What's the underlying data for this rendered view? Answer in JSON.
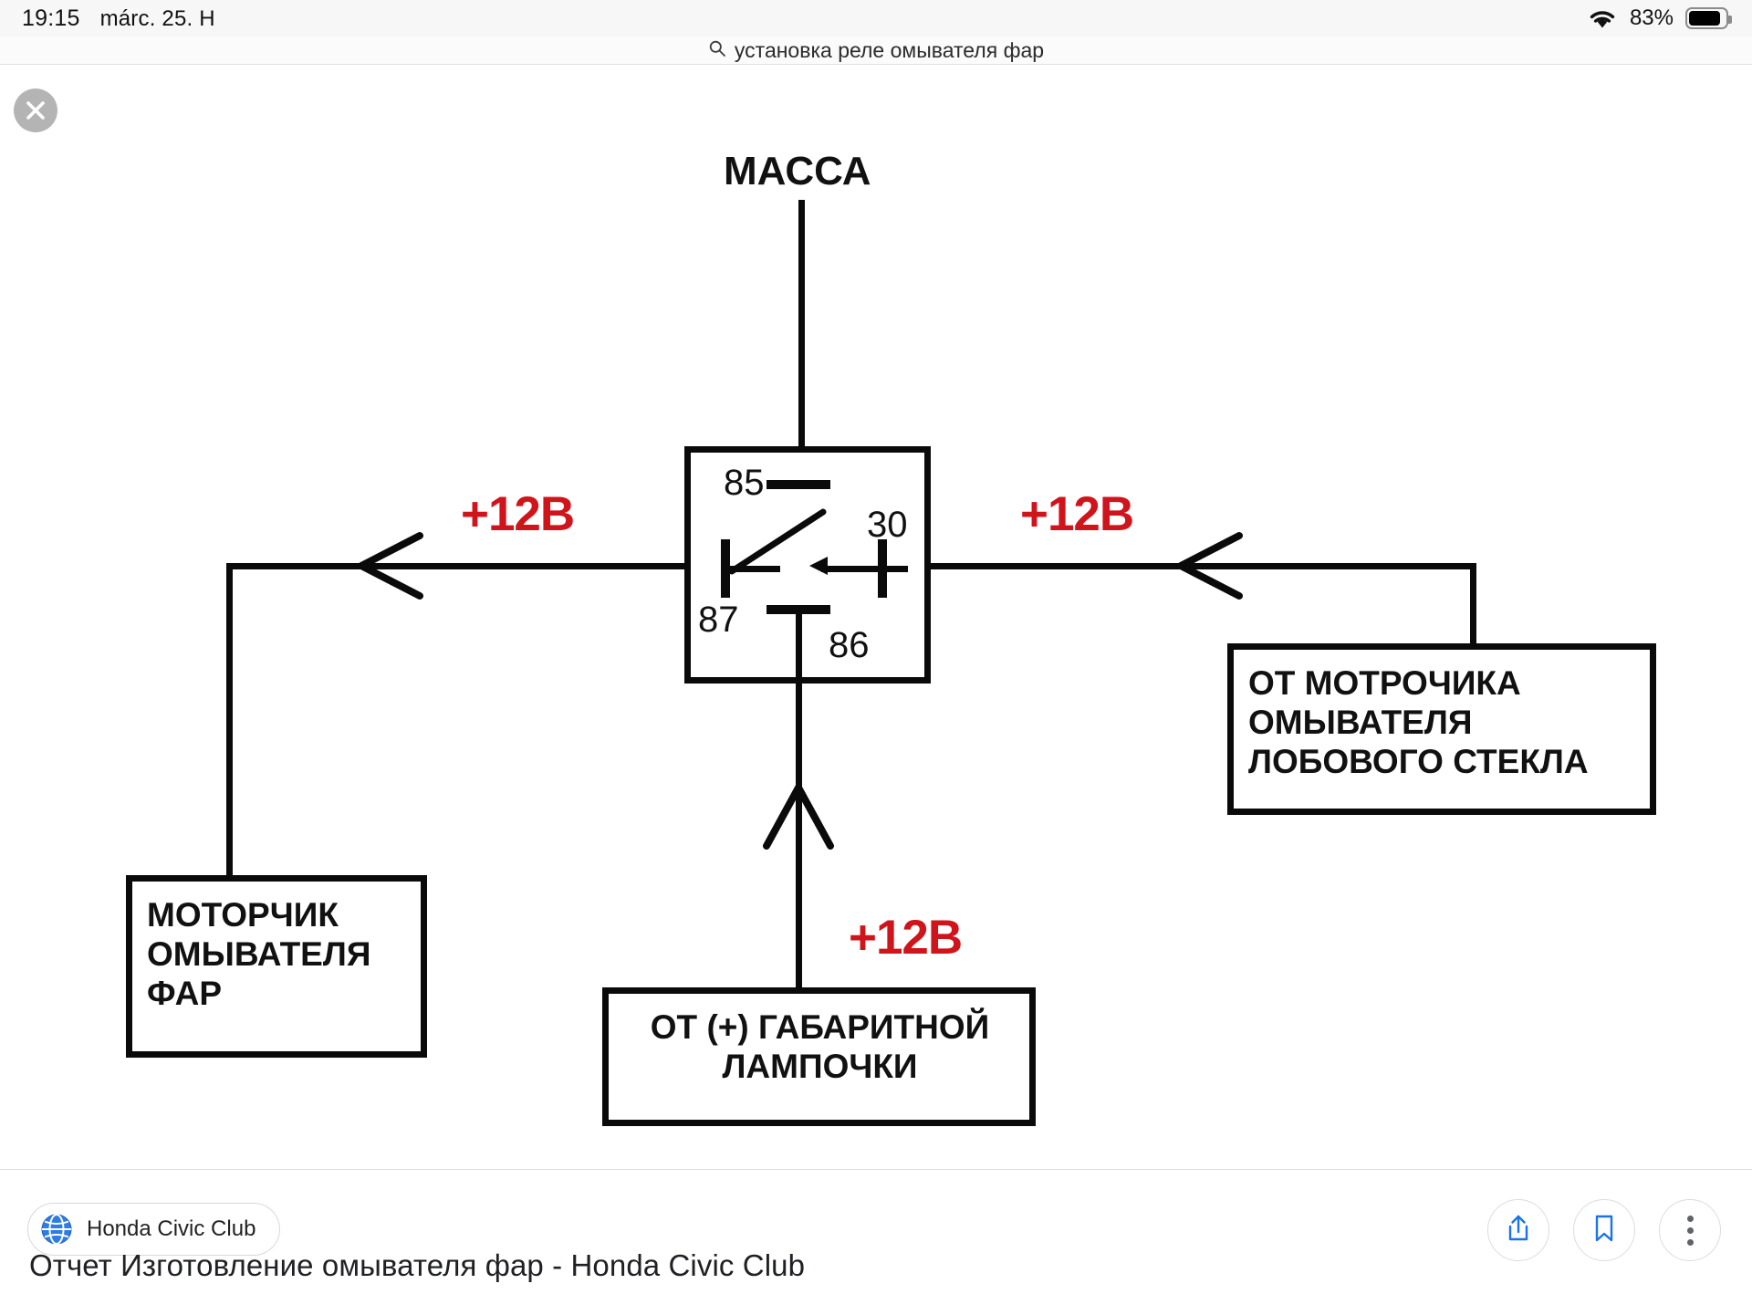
{
  "status_bar": {
    "time": "19:15",
    "date": "márc. 25. H",
    "wifi_icon": "wifi-icon",
    "battery_percent": "83%",
    "battery_icon": "battery-icon"
  },
  "search": {
    "icon": "search-icon",
    "query": "установка реле омывателя фар"
  },
  "viewer": {
    "close_icon": "close-icon"
  },
  "diagram": {
    "title_label": "МАССА",
    "relay": {
      "terminals": [
        {
          "id": "85",
          "label": "85",
          "position": "top-left-inside"
        },
        {
          "id": "30",
          "label": "30",
          "position": "right"
        },
        {
          "id": "87",
          "label": "87",
          "position": "left"
        },
        {
          "id": "86",
          "label": "86",
          "position": "bottom"
        }
      ]
    },
    "voltage_labels": [
      {
        "id": "left",
        "text": "+12B"
      },
      {
        "id": "right",
        "text": "+12B"
      },
      {
        "id": "bottom",
        "text": "+12B"
      }
    ],
    "boxes": [
      {
        "id": "headlight-washer-motor",
        "lines": [
          "МОТОРЧИК",
          "ОМЫВАТЕЛЯ",
          "ФАР"
        ],
        "align": "left"
      },
      {
        "id": "windshield-washer-motor",
        "lines": [
          "ОТ МОТРОЧИКА",
          "ОМЫВАТЕЛЯ",
          "ЛОБОВОГО СТЕКЛА"
        ],
        "align": "left"
      },
      {
        "id": "parking-lamp-positive",
        "lines": [
          "ОТ (+) ГАБАРИТНОЙ",
          "ЛАМПОЧКИ"
        ],
        "align": "center"
      }
    ],
    "colors": {
      "wire": "#0a0a0a",
      "voltage_text": "#d0141b",
      "background": "#ffffff"
    }
  },
  "bottom": {
    "source_icon": "globe-icon",
    "source_name": "Honda Civic Club",
    "actions": [
      {
        "id": "share",
        "icon": "share-icon"
      },
      {
        "id": "bookmark",
        "icon": "bookmark-icon"
      },
      {
        "id": "more",
        "icon": "more-vertical-icon"
      }
    ],
    "page_title": "Отчет Изготовление омывателя фар - Honda Civic Club"
  }
}
